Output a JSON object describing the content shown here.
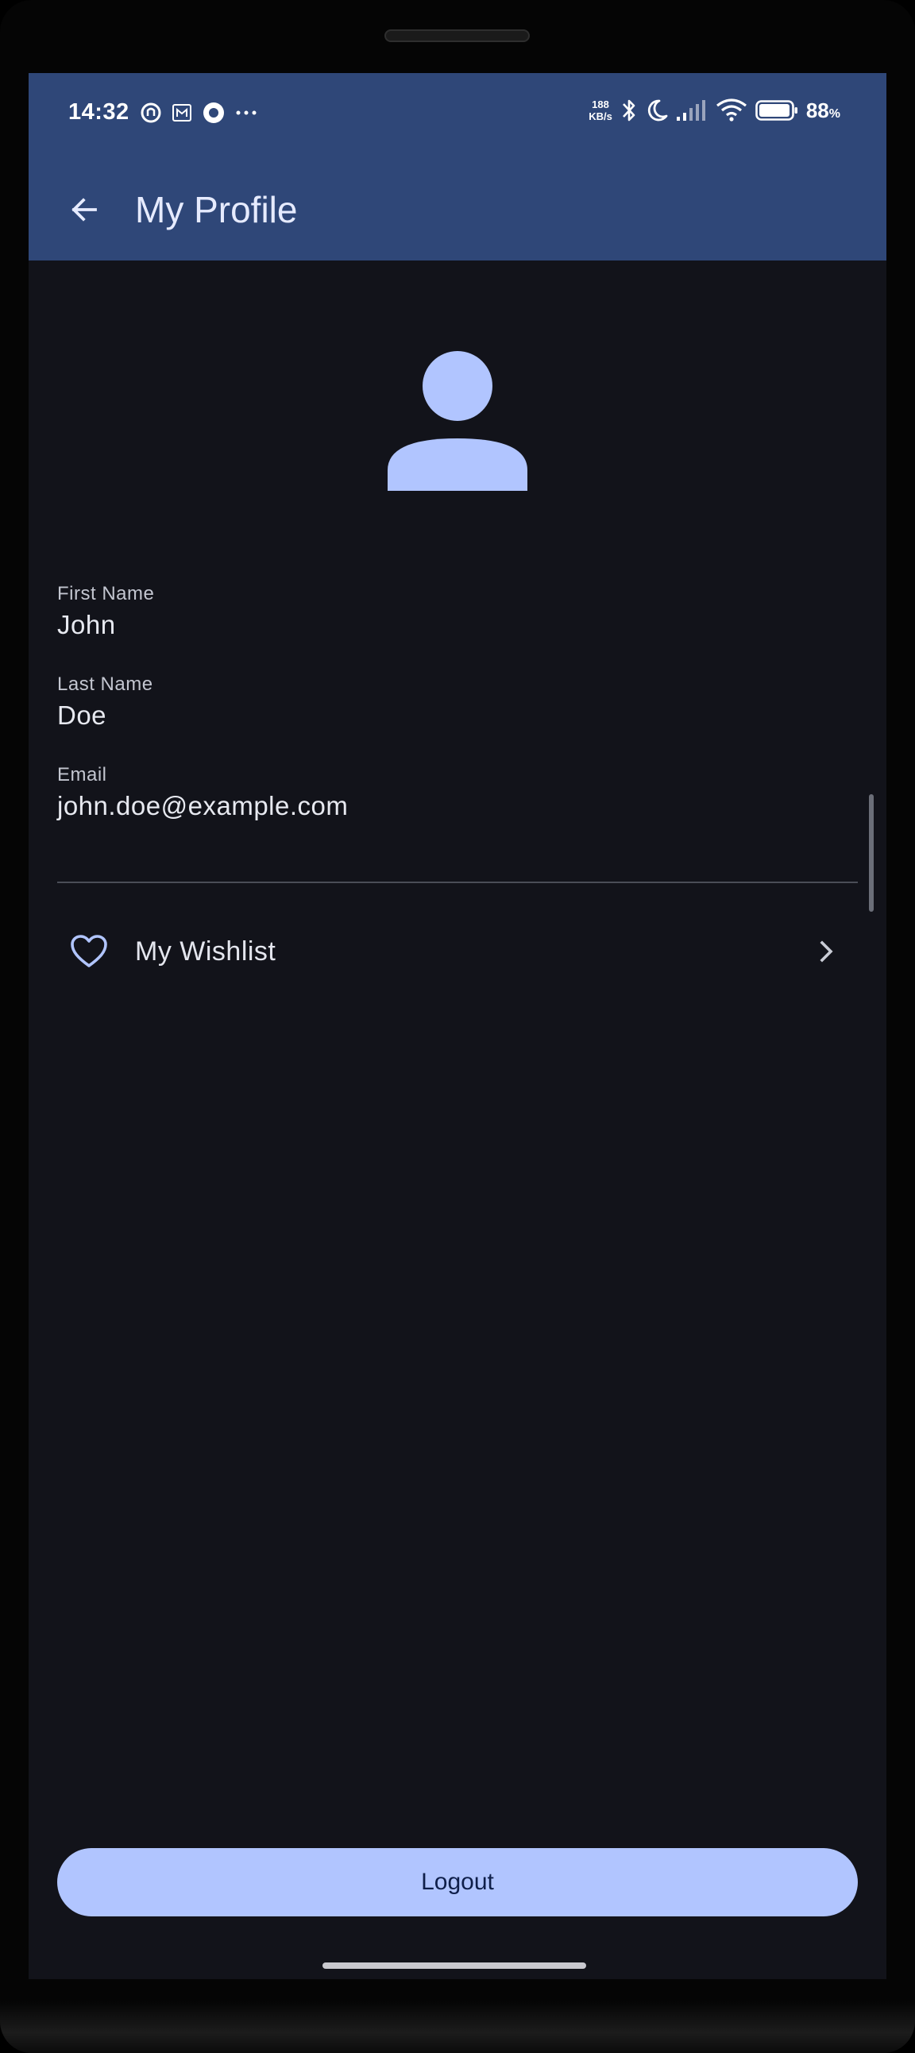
{
  "status_bar": {
    "time": "14:32",
    "notification_icons": [
      "swirl-app-icon",
      "m-app-icon",
      "circle-record-icon",
      "more-notifications-icon"
    ],
    "net_speed_value": "188",
    "net_speed_unit": "KB/s",
    "system_icons": [
      "bluetooth-icon",
      "moon-icon",
      "signal-icon",
      "wifi-icon",
      "battery-icon"
    ],
    "battery_percent": "88",
    "battery_percent_sign": "%"
  },
  "app_bar": {
    "back_icon": "arrow-back-icon",
    "title": "My Profile"
  },
  "profile": {
    "avatar_icon": "person-icon",
    "fields": [
      {
        "label": "First Name",
        "value": "John"
      },
      {
        "label": "Last Name",
        "value": "Doe"
      },
      {
        "label": "Email",
        "value": "john.doe@example.com"
      }
    ]
  },
  "menu": {
    "wishlist": {
      "icon": "heart-outline-icon",
      "label": "My Wishlist",
      "trailing_icon": "chevron-right-icon"
    }
  },
  "actions": {
    "logout_label": "Logout"
  },
  "colors": {
    "app_bar": "#2f4778",
    "background": "#12131a",
    "accent": "#b1c5ff",
    "text_primary": "#e7e9f0",
    "text_secondary": "#c3c6d0"
  }
}
